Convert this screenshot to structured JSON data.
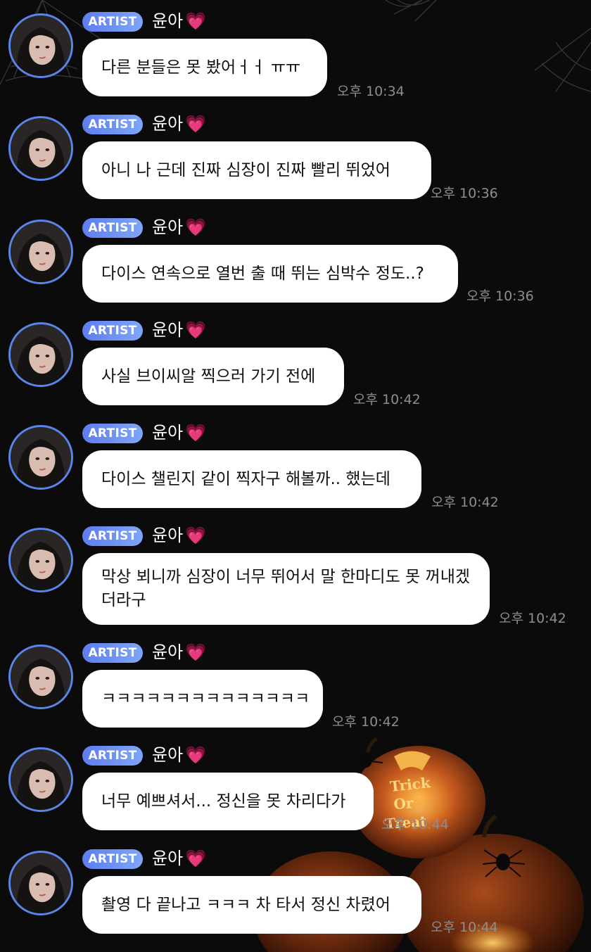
{
  "background": {
    "halloween_sign": "Trick Or Treat"
  },
  "chat": {
    "messages": [
      {
        "badge": "ARTIST",
        "sender": "윤아",
        "heart": "💗",
        "text": "다른 분들은 못 봤어ㅓㅓ ㅠㅠ",
        "time": "오후 10:34"
      },
      {
        "badge": "ARTIST",
        "sender": "윤아",
        "heart": "💗",
        "text": "아니 나 근데 진짜 심장이 진짜 빨리 뛰었어",
        "time": "오후 10:36"
      },
      {
        "badge": "ARTIST",
        "sender": "윤아",
        "heart": "💗",
        "text": "다이스 연속으로 열번 출 때 뛰는 심박수 정도..?",
        "time": "오후 10:36"
      },
      {
        "badge": "ARTIST",
        "sender": "윤아",
        "heart": "💗",
        "text": "사실 브이씨알 찍으러 가기 전에",
        "time": "오후 10:42"
      },
      {
        "badge": "ARTIST",
        "sender": "윤아",
        "heart": "💗",
        "text": "다이스 챌린지 같이 찍자구 해볼까.. 했는데",
        "time": "오후 10:42"
      },
      {
        "badge": "ARTIST",
        "sender": "윤아",
        "heart": "💗",
        "text": "막상 뵈니까 심장이 너무 뛰어서 말 한마디도 못 꺼내겠더라구",
        "time": "오후 10:42"
      },
      {
        "badge": "ARTIST",
        "sender": "윤아",
        "heart": "💗",
        "text": "ㅋㅋㅋㅋㅋㅋㅋㅋㅋㅋㅋㅋㅋㅋ",
        "time": "오후 10:42"
      },
      {
        "badge": "ARTIST",
        "sender": "윤아",
        "heart": "💗",
        "text": "너무 예쁘셔서... 정신을 못 차리다가",
        "time": "오후 10:44"
      },
      {
        "badge": "ARTIST",
        "sender": "윤아",
        "heart": "💗",
        "text": "촬영 다 끝나고 ㅋㅋㅋ 차 타서 정신 차렸어",
        "time": "오후 10:44"
      }
    ]
  }
}
